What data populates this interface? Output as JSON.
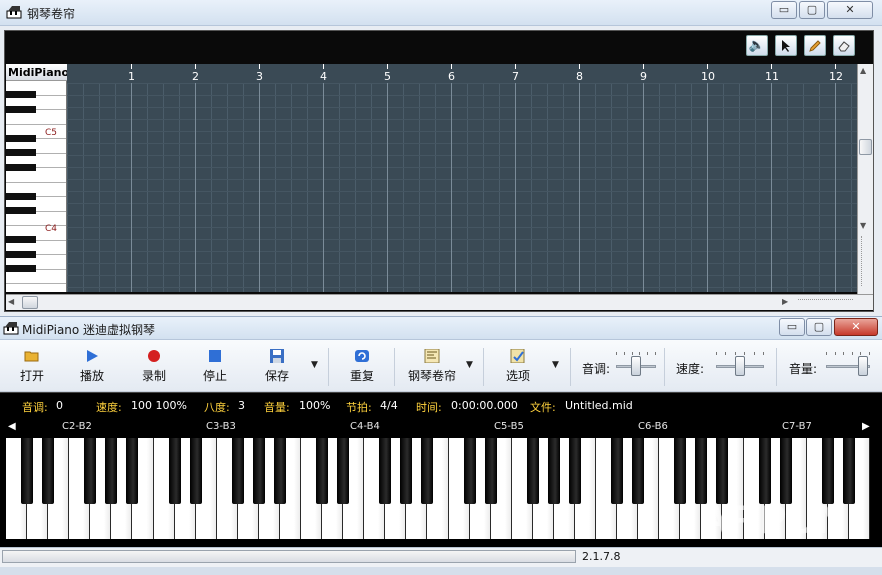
{
  "top_window": {
    "title": "钢琴卷帘",
    "minimize": "▭",
    "maximize": "▢",
    "close": "✕",
    "tools": [
      "speaker-icon",
      "cursor-icon",
      "pencil-icon",
      "eraser-icon"
    ],
    "keyboard_header": "MidiPiano",
    "key_labels": [
      "C5",
      "C4"
    ],
    "measures": [
      "1",
      "2",
      "3",
      "4",
      "5",
      "6",
      "7",
      "8",
      "9",
      "10",
      "11",
      "12"
    ]
  },
  "main_window": {
    "title": "MidiPiano 迷迪虚拟钢琴",
    "minimize": "▭",
    "maximize": "▢",
    "close": "✕",
    "toolbar": {
      "open": "打开",
      "play": "播放",
      "record": "录制",
      "stop": "停止",
      "save": "保存",
      "repeat": "重复",
      "piano_roll": "钢琴卷帘",
      "options": "选项",
      "pitch_label": "音调:",
      "speed_label": "速度:",
      "volume_label": "音量:"
    },
    "sliders": {
      "pitch": 0.5,
      "speed": 0.5,
      "volume": 0.95
    },
    "status": {
      "pitch_k": "音调:",
      "pitch_v": "0",
      "speed_k": "速度:",
      "speed_v": "100  100%",
      "octave_k": "八度:",
      "octave_v": "3",
      "volume_k": "音量:",
      "volume_v": "100%",
      "beat_k": "节拍:",
      "beat_v": "4/4",
      "time_k": "时间:",
      "time_v": "0:00:00.000",
      "file_k": "文件:",
      "file_v": "Untitled.mid"
    },
    "octaves": [
      "C2-B2",
      "C3-B3",
      "C4-B4",
      "C5-B5",
      "C6-B6",
      "C7-B7"
    ],
    "watermark": "ARPUN",
    "version": "2.1.7.8"
  },
  "colors": {
    "grid_bg": "#3a4a55",
    "status_key": "#ffd23d",
    "record_red": "#d42020",
    "accent_blue": "#2f6fd6"
  }
}
